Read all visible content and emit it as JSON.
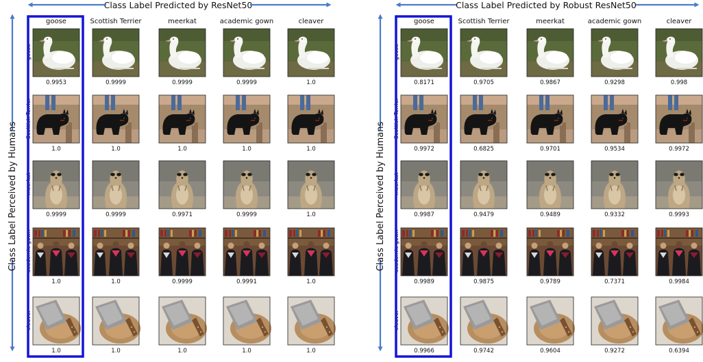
{
  "colors": {
    "arrow": "#4a7bc8",
    "highlight": "#1414d6"
  },
  "classes": [
    "goose",
    "Scottish Terrier",
    "meerkat",
    "academic gown",
    "cleaver"
  ],
  "row_axis_title": "Class Label Perceived by Humans",
  "icons": [
    "goose-image",
    "terrier-image",
    "meerkat-image",
    "gown-image",
    "cleaver-image"
  ],
  "panels": [
    {
      "title": "Class Label Predicted by ResNet50",
      "scores": [
        [
          "0.9953",
          "0.9999",
          "0.9999",
          "0.9999",
          "1.0"
        ],
        [
          "1.0",
          "1.0",
          "1.0",
          "1.0",
          "1.0"
        ],
        [
          "0.9999",
          "0.9999",
          "0.9971",
          "0.9999",
          "1.0"
        ],
        [
          "1.0",
          "1.0",
          "0.9999",
          "0.9991",
          "1.0"
        ],
        [
          "1.0",
          "1.0",
          "1.0",
          "1.0",
          "1.0"
        ]
      ]
    },
    {
      "title": "Class Label Predicted by Robust ResNet50",
      "scores": [
        [
          "0.8171",
          "0.9705",
          "0.9867",
          "0.9298",
          "0.998"
        ],
        [
          "0.9972",
          "0.6825",
          "0.9701",
          "0.9534",
          "0.9972"
        ],
        [
          "0.9987",
          "0.9479",
          "0.9489",
          "0.9332",
          "0.9993"
        ],
        [
          "0.9989",
          "0.9875",
          "0.9789",
          "0.7371",
          "0.9984"
        ],
        [
          "0.9966",
          "0.9742",
          "0.9604",
          "0.9272",
          "0.6394"
        ]
      ]
    }
  ]
}
